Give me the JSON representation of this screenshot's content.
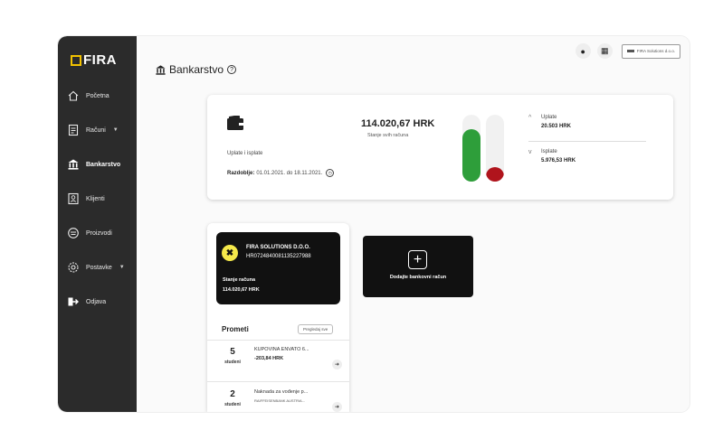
{
  "sidebar": {
    "logo": "FIRA",
    "items": [
      {
        "label": "Početna",
        "icon": "home-icon",
        "has_caret": false,
        "active": false
      },
      {
        "label": "Računi",
        "icon": "invoice-icon",
        "has_caret": true,
        "active": false
      },
      {
        "label": "Bankarstvo",
        "icon": "bank-icon",
        "has_caret": false,
        "active": true
      },
      {
        "label": "Klijenti",
        "icon": "client-icon",
        "has_caret": false,
        "active": false
      },
      {
        "label": "Proizvodi",
        "icon": "product-icon",
        "has_caret": false,
        "active": false
      },
      {
        "label": "Postavke",
        "icon": "settings-icon",
        "has_caret": true,
        "active": false
      },
      {
        "label": "Odjava",
        "icon": "logout-icon",
        "has_caret": false,
        "active": false
      }
    ]
  },
  "header": {
    "title": "Bankarstvo",
    "help_symbol": "?",
    "company_label": "FIRA Solutions d.o.o."
  },
  "summary": {
    "label": "Uplate i isplate",
    "period_label": "Razdoblje:",
    "period_value": "01.01.2021. do 18.11.2021.",
    "total": "114.020,67 HRK",
    "total_caption": "Stanje svih računa",
    "income_label": "Uplate",
    "income_value": "20.503 HRK",
    "expense_label": "Isplate",
    "expense_value": "5.976,53 HRK",
    "income_fill": 0.78,
    "expense_fill": 0.22,
    "income_color": "#2e9e3a",
    "expense_color": "#b0141c"
  },
  "account": {
    "name": "FIRA SOLUTIONS D.O.O.",
    "iban": "HR0724840081135227988",
    "balance_label": "Stanje računa",
    "balance": "114.020,67 HRK"
  },
  "add_account": {
    "label": "Dodajte bankovni račun"
  },
  "transactions": {
    "title": "Prometi",
    "view_all": "Pregledaj sve",
    "items": [
      {
        "day": "5",
        "month": "studeni",
        "desc": "KUPOVINA ENVATO 6...",
        "amount": "-203,84 HRK"
      },
      {
        "day": "2",
        "month": "studeni",
        "desc": "Naknada za vođenje p...",
        "amount": "RAIFFEISENBANK AUSTRIA..."
      }
    ]
  }
}
